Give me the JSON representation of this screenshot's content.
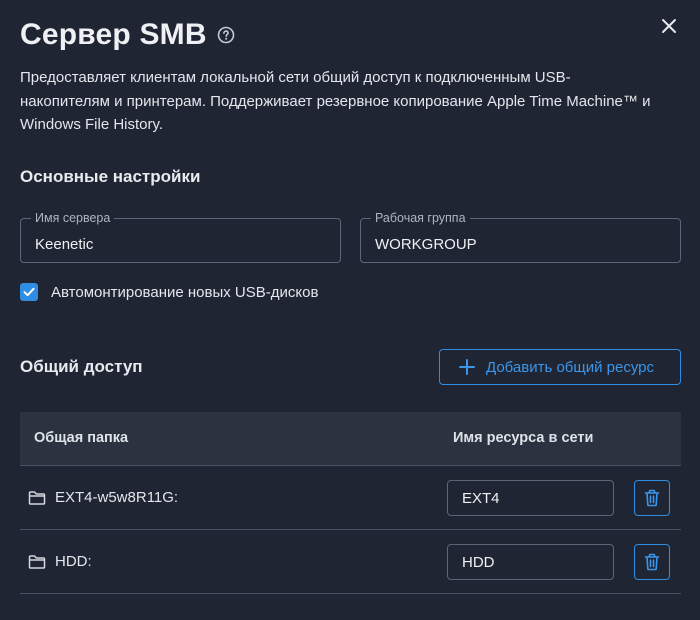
{
  "header": {
    "title": "Сервер SMB",
    "help_icon": "help-circle-icon",
    "close_icon": "close-icon"
  },
  "description": "Предоставляет клиентам локальной сети общий доступ к подключенным USB-накопителям и принтерам. Поддерживает резервное копирование Apple Time Machine™ и Windows File History.",
  "basic_settings": {
    "title": "Основные настройки",
    "server_name": {
      "label": "Имя сервера",
      "value": "Keenetic"
    },
    "workgroup": {
      "label": "Рабочая группа",
      "value": "WORKGROUP"
    },
    "automount": {
      "label": "Автомонтирование новых USB-дисков",
      "checked": true
    }
  },
  "shared_access": {
    "title": "Общий доступ",
    "add_button": "Добавить общий ресурс",
    "columns": [
      "Общая папка",
      "Имя ресурса в сети"
    ],
    "rows": [
      {
        "folder": "EXT4-w5w8R11G:",
        "share_name": "EXT4"
      },
      {
        "folder": "HDD:",
        "share_name": "HDD"
      }
    ]
  },
  "colors": {
    "background": "#1f2532",
    "table_header": "#2b3240",
    "accent": "#2f8de4",
    "border": "#5d6578"
  }
}
